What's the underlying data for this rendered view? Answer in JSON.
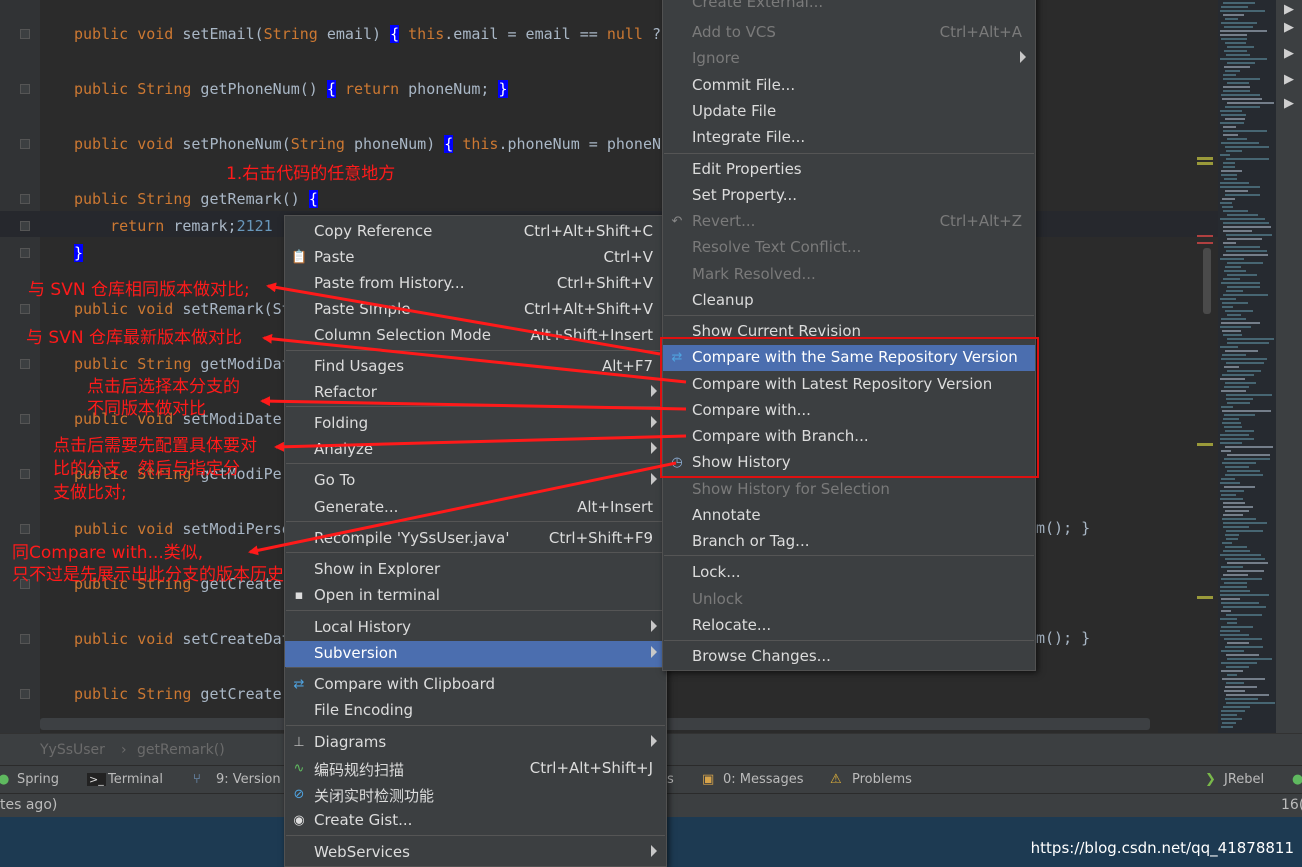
{
  "code": [
    {
      "text": "public void setEmail(String email) { this.email = email == null ?"
    },
    {
      "text": "public String getPhoneNum() { return phoneNum; }"
    },
    {
      "text": "public void setPhoneNum(String phoneNum) { this.phoneNum = phoneNu"
    },
    {
      "text": "public String getRemark() {"
    },
    {
      "text": "    return remark;2121"
    },
    {
      "text": "}"
    },
    {
      "text": "public void setRemark(St"
    },
    {
      "text": "public String getModiDat"
    },
    {
      "text": "public void setModiDate"
    },
    {
      "text": "public String getModiPer"
    },
    {
      "text": "public void setModiPerso"
    },
    {
      "text": "public String getCreate"
    },
    {
      "text": "public void setCreateDat"
    },
    {
      "text": "public String getCreate"
    }
  ],
  "code_tail": {
    "right1": "m(); }",
    "right2": "m(); }"
  },
  "breadcrumb": {
    "class": "YySsUser",
    "sep": "›",
    "method": "getRemark()"
  },
  "tool_windows": [
    "Spring",
    "Terminal",
    "9: Version",
    "0: Messages",
    "Problems",
    "JRebel"
  ],
  "tool_window_s": "s",
  "status": {
    "left": "tes ago)",
    "right": "16("
  },
  "watermark": "https://blog.csdn.net/qq_41878811",
  "context_menu": [
    {
      "label": "Copy Reference",
      "shortcut": "Ctrl+Alt+Shift+C"
    },
    {
      "label": "Paste",
      "shortcut": "Ctrl+V",
      "icon": "paste-icon"
    },
    {
      "label": "Paste from History...",
      "shortcut": "Ctrl+Shift+V"
    },
    {
      "label": "Paste Simple",
      "shortcut": "Ctrl+Alt+Shift+V"
    },
    {
      "label": "Column Selection Mode",
      "shortcut": "Alt+Shift+Insert"
    },
    {
      "label": "Find Usages",
      "shortcut": "Alt+F7"
    },
    {
      "label": "Refactor",
      "submenu": true
    },
    {
      "label": "Folding",
      "submenu": true
    },
    {
      "label": "Analyze",
      "submenu": true
    },
    {
      "label": "Go To",
      "submenu": true
    },
    {
      "label": "Generate...",
      "shortcut": "Alt+Insert"
    },
    {
      "label": "Recompile 'YySsUser.java'",
      "shortcut": "Ctrl+Shift+F9"
    },
    {
      "label": "Show in Explorer"
    },
    {
      "label": "Open in terminal",
      "icon": "terminal-icon"
    },
    {
      "label": "Local History",
      "submenu": true
    },
    {
      "label": "Subversion",
      "submenu": true,
      "selected": true
    },
    {
      "label": "Compare with Clipboard",
      "icon": "compare-icon"
    },
    {
      "label": "File Encoding"
    },
    {
      "label": "Diagrams",
      "submenu": true,
      "icon": "diagram-icon"
    },
    {
      "label": "编码规约扫描",
      "shortcut": "Ctrl+Alt+Shift+J",
      "icon": "scan-icon"
    },
    {
      "label": "关闭实时检测功能",
      "icon": "disable-icon"
    },
    {
      "label": "Create Gist...",
      "icon": "github-icon"
    },
    {
      "label": "WebServices",
      "submenu": true
    }
  ],
  "svn_menu": [
    {
      "label": "Create External...",
      "disabled": true
    },
    {
      "label": "Add to VCS",
      "shortcut": "Ctrl+Alt+A",
      "disabled": true
    },
    {
      "label": "Ignore",
      "submenu": true,
      "disabled": true
    },
    {
      "label": "Commit File..."
    },
    {
      "label": "Update File"
    },
    {
      "label": "Integrate File..."
    },
    {
      "label": "Edit Properties"
    },
    {
      "label": "Set Property..."
    },
    {
      "label": "Revert...",
      "shortcut": "Ctrl+Alt+Z",
      "disabled": true,
      "icon": "revert-icon"
    },
    {
      "label": "Resolve Text Conflict...",
      "disabled": true
    },
    {
      "label": "Mark Resolved...",
      "disabled": true
    },
    {
      "label": "Cleanup"
    },
    {
      "label": "Show Current Revision"
    },
    {
      "label": "Compare with the Same Repository Version",
      "selected": true,
      "icon": "compare-icon"
    },
    {
      "label": "Compare with Latest Repository Version"
    },
    {
      "label": "Compare with..."
    },
    {
      "label": "Compare with Branch..."
    },
    {
      "label": "Show History",
      "icon": "history-icon"
    },
    {
      "label": "Show History for Selection",
      "disabled": true
    },
    {
      "label": "Annotate"
    },
    {
      "label": "Branch or Tag..."
    },
    {
      "label": "Lock..."
    },
    {
      "label": "Unlock",
      "disabled": true
    },
    {
      "label": "Relocate..."
    },
    {
      "label": "Browse Changes..."
    }
  ],
  "annotations": {
    "a1": "1.右击代码的任意地方",
    "a2": "与 SVN 仓库相同版本做对比;",
    "a3": "与 SVN 仓库最新版本做对比",
    "a4l1": "点击后选择本分支的",
    "a4l2": "不同版本做对比",
    "a5l1": "点击后需要先配置具体要对",
    "a5l2": "比的分支，然后与指定分",
    "a5l3": "支做比对;",
    "a6l1": "同Compare with...类似,",
    "a6l2": "只不过是先展示出此分支的版本历史"
  },
  "colors": {
    "accent": "#4b6eaf",
    "annotation": "#ff1a1a",
    "keyword": "#cc7832",
    "brace_bg": "#0000ff"
  }
}
